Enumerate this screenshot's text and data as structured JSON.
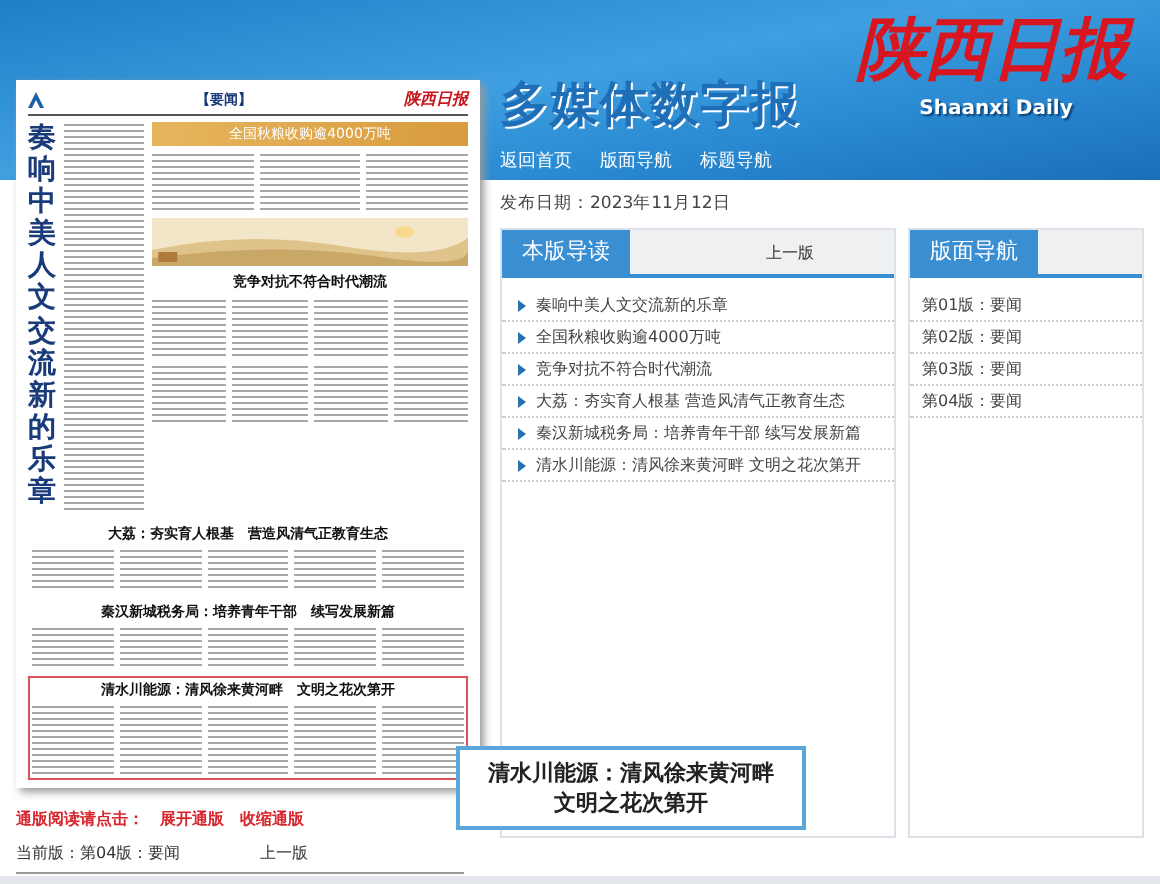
{
  "site": {
    "title": "多媒体数字报",
    "logo": "陕西日报",
    "logo_subtitle": "Shaanxi Daily",
    "nav": [
      "返回首页",
      "版面导航",
      "标题导航"
    ]
  },
  "publish_date": {
    "label": "发布日期：",
    "value": "2023年11月12日"
  },
  "paper_page": {
    "edition_tag": "【要闻】",
    "masthead": "陕西日报",
    "lead_headline": "奏响中美人文交流新的乐章",
    "banner_headline": "全国秋粮收购逾4000万吨",
    "feature_headline": "竞争对抗不符合时代潮流",
    "stories": [
      {
        "headline": "大荔：夯实育人根基　营造风清气正教育生态",
        "highlighted": false
      },
      {
        "headline": "秦汉新城税务局：培养青年干部　续写发展新篇",
        "highlighted": false
      },
      {
        "headline": "清水川能源：清风徐来黄河畔　文明之花次第开",
        "highlighted": true
      }
    ]
  },
  "spread_links": {
    "label": "通版阅读请点击：",
    "links": [
      "展开通版",
      "收缩通版"
    ]
  },
  "current_page": {
    "label": "当前版：第04版：要闻",
    "prev": "上一版"
  },
  "guide_panel": {
    "title": "本版导读",
    "prev": "上一版",
    "items": [
      "奏响中美人文交流新的乐章",
      "全国秋粮收购逾4000万吨",
      "竞争对抗不符合时代潮流",
      "大荔：夯实育人根基 营造风清气正教育生态",
      "秦汉新城税务局：培养青年干部 续写发展新篇",
      "清水川能源：清风徐来黄河畔 文明之花次第开"
    ]
  },
  "page_nav_panel": {
    "title": "版面导航",
    "items": [
      "第01版：要闻",
      "第02版：要闻",
      "第03版：要闻",
      "第04版：要闻"
    ]
  },
  "callout": {
    "lines": [
      "清水川能源：清风徐来黄河畔",
      "文明之花次第开"
    ]
  }
}
